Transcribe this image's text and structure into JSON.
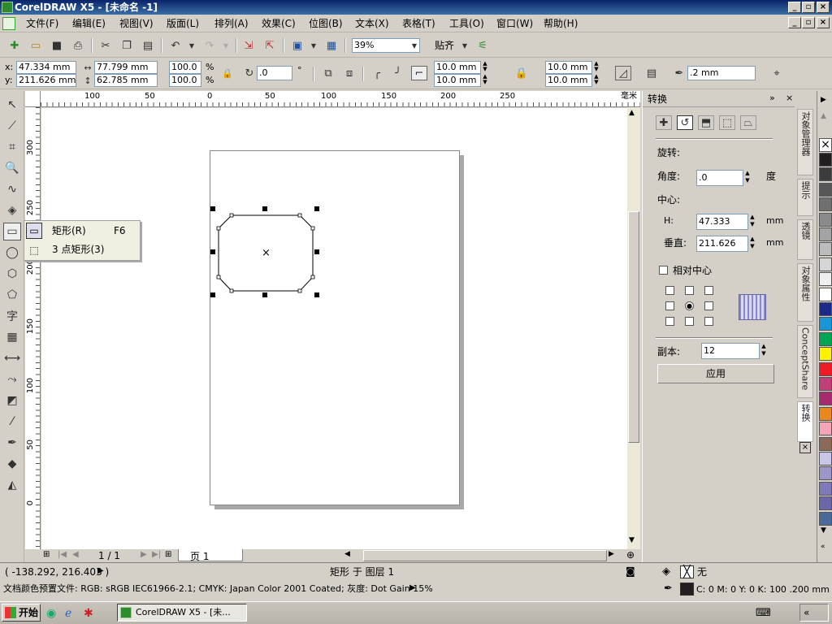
{
  "window": {
    "title": "CorelDRAW X5 - [未命名 -1]"
  },
  "menu": [
    "文件(F)",
    "编辑(E)",
    "视图(V)",
    "版面(L)",
    "排列(A)",
    "效果(C)",
    "位图(B)",
    "文本(X)",
    "表格(T)",
    "工具(O)",
    "窗口(W)",
    "帮助(H)"
  ],
  "standard_toolbar": {
    "zoom": "39%",
    "snap_label": "贴齐"
  },
  "property_bar": {
    "x": "47.334 mm",
    "y": "211.626 mm",
    "width": "77.799 mm",
    "height": "62.785 mm",
    "scale_x": "100.0",
    "scale_y": "100.0",
    "percent": "%",
    "rotation": ".0",
    "degree_symbol": "°",
    "corner_tl": "10.0 mm",
    "corner_bl": "10.0 mm",
    "corner_tr": "10.0 mm",
    "corner_br": "10.0 mm",
    "outline_width": ".2 mm"
  },
  "ruler_h_labels": [
    "100",
    "50",
    "0",
    "50",
    "100",
    "150",
    "200",
    "250",
    "毫米"
  ],
  "ruler_v_labels": [
    "300",
    "250",
    "200",
    "150",
    "100",
    "50",
    "0"
  ],
  "flyout": {
    "items": [
      {
        "label": "矩形(R)",
        "shortcut": "F6"
      },
      {
        "label": "3 点矩形(3)",
        "shortcut": ""
      }
    ]
  },
  "page_nav": {
    "current": "1 / 1",
    "tab": "页 1"
  },
  "docker": {
    "title": "转换",
    "section": "旋转:",
    "angle_label": "角度:",
    "angle_value": ".0",
    "angle_unit": "度",
    "center_label": "中心:",
    "h_label": "H:",
    "h_value": "47.333",
    "h_unit": "mm",
    "v_label": "垂直:",
    "v_value": "211.626",
    "v_unit": "mm",
    "relative_center": "相对中心",
    "copies_label": "副本:",
    "copies_value": "12",
    "apply": "应用"
  },
  "side_tabs": [
    "对象管理器",
    "提示",
    "透镜",
    "对象属性",
    "ConceptShare",
    "转换"
  ],
  "palette": [
    "#ffffff",
    "#231f20",
    "#3c3c3c",
    "#575757",
    "#707070",
    "#8a8a8a",
    "#a3a3a3",
    "#bcbcbc",
    "#d6d6d6",
    "#efefef",
    "#ffffff",
    "#1b2a8a",
    "#1996d8",
    "#00a651",
    "#fff200",
    "#ed1c24",
    "#c0407a",
    "#a52a6e",
    "#e8891e",
    "#f4a5b8",
    "#8c6a5a",
    "#c8c6e8",
    "#9a96c8",
    "#7e7ab8",
    "#6a66a8",
    "#4a6a9a"
  ],
  "status": {
    "coords": "( -138.292, 216.403 )",
    "object": "矩形 于 图层 1",
    "fill": "无",
    "profile": "文档颜色预置文件: RGB: sRGB IEC61966-2.1; CMYK: Japan Color 2001 Coated; 灰度: Dot Gain 15%",
    "outline": "C: 0 M: 0 Y: 0 K: 100  .200 mm"
  },
  "taskbar": {
    "start": "开始",
    "task": "CorelDRAW X5 - [未..."
  }
}
